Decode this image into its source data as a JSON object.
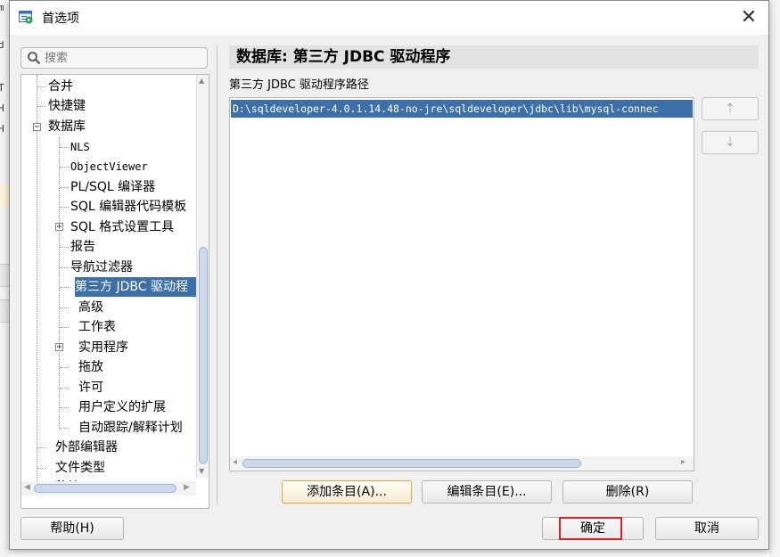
{
  "background": {
    "left_chars": [
      "m",
      "d",
      "T",
      "H",
      "H",
      "e",
      "f"
    ]
  },
  "dialog": {
    "title": "首选项",
    "close_glyph": "✕"
  },
  "search": {
    "placeholder": "搜索"
  },
  "tree": {
    "items": [
      {
        "label": "合并",
        "level": 0
      },
      {
        "label": "快捷键",
        "level": 0
      },
      {
        "label": "数据库",
        "level": 0,
        "expanded": true
      },
      {
        "label": "NLS",
        "level": 1
      },
      {
        "label": "ObjectViewer",
        "level": 1
      },
      {
        "label": "PL/SQL 编译器",
        "level": 1
      },
      {
        "label": "SQL 编辑器代码模板",
        "level": 1
      },
      {
        "label": "SQL 格式设置工具",
        "level": 1,
        "collapsed": true
      },
      {
        "label": "报告",
        "level": 1
      },
      {
        "label": "导航过滤器",
        "level": 1
      },
      {
        "label": "第三方 JDBC 驱动程",
        "level": 1,
        "selected": true
      },
      {
        "label": "高级",
        "level": 1
      },
      {
        "label": "工作表",
        "level": 1
      },
      {
        "label": "实用程序",
        "level": 1,
        "collapsed": true
      },
      {
        "label": "拖放",
        "level": 1
      },
      {
        "label": "许可",
        "level": 1
      },
      {
        "label": "用户定义的扩展",
        "level": 1
      },
      {
        "label": "自动跟踪/解释计划",
        "level": 1
      },
      {
        "label": "外部编辑器",
        "level": 0
      },
      {
        "label": "文件类型",
        "level": 0
      },
      {
        "label": "移植",
        "level": 0,
        "collapsed": true
      }
    ]
  },
  "panel": {
    "title": "数据库: 第三方 JDBC 驱动程序",
    "section_label": "第三方 JDBC 驱动程序路径",
    "paths": [
      "D:\\sqldeveloper-4.0.1.14.48-no-jre\\sqldeveloper\\jdbc\\lib\\mysql-connec"
    ],
    "move_up_glyph": "⇡",
    "move_down_glyph": "⇣"
  },
  "buttons": {
    "add": "添加条目(A)...",
    "edit": "编辑条目(E)...",
    "delete": "删除(R)",
    "help": "帮助(H)",
    "ok": "确定",
    "cancel": "取消"
  },
  "colors": {
    "selection": "#3d6fa8",
    "focus_border": "#e0a83c",
    "highlight_box": "#e02020"
  }
}
